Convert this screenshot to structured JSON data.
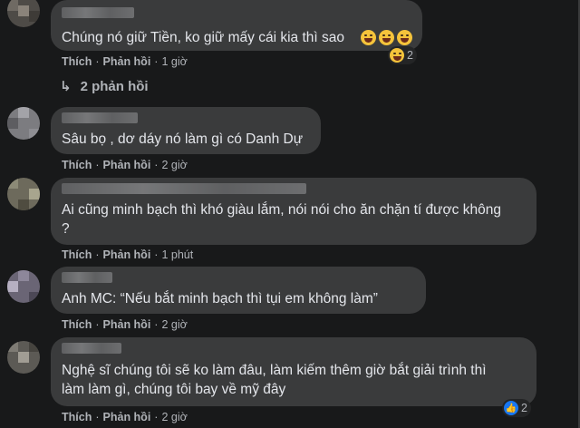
{
  "comments": [
    {
      "text": "Chúng nó giữ Tiền, ko giữ mấy cái kia thì sao",
      "like": "Thích",
      "reply": "Phản hồi",
      "time": "1 giờ",
      "reaction_count": "2",
      "reaction_icon": "laughing-emoji"
    },
    {
      "text": "Sâu bọ , dơ dáy nó làm gì có Danh Dự",
      "like": "Thích",
      "reply": "Phản hồi",
      "time": "2 giờ"
    },
    {
      "text": "Ai cũng minh bạch thì khó giàu lắm, nói nói cho ăn chặn tí được không\n?",
      "like": "Thích",
      "reply": "Phản hồi",
      "time": "1 phút"
    },
    {
      "text": "Anh MC: “Nếu bắt minh bạch thì tụi em không làm”",
      "like": "Thích",
      "reply": "Phản hồi",
      "time": "2 giờ"
    },
    {
      "text": "Nghệ sĩ chúng tôi sẽ ko làm đâu, làm kiếm thêm giờ bắt giải trình thì\nlàm làm gì, chúng tôi bay về mỹ đây",
      "like": "Thích",
      "reply": "Phản hồi",
      "time": "2 giờ",
      "reaction_count": "2",
      "reaction_icon": "like-icon"
    }
  ],
  "replies_link": "2 phản hồi",
  "colors": {
    "background": "#18191a",
    "bubble": "#3a3b3c",
    "text": "#e4e6eb",
    "meta": "#b0b3b8",
    "like_blue": "#1877f2"
  }
}
